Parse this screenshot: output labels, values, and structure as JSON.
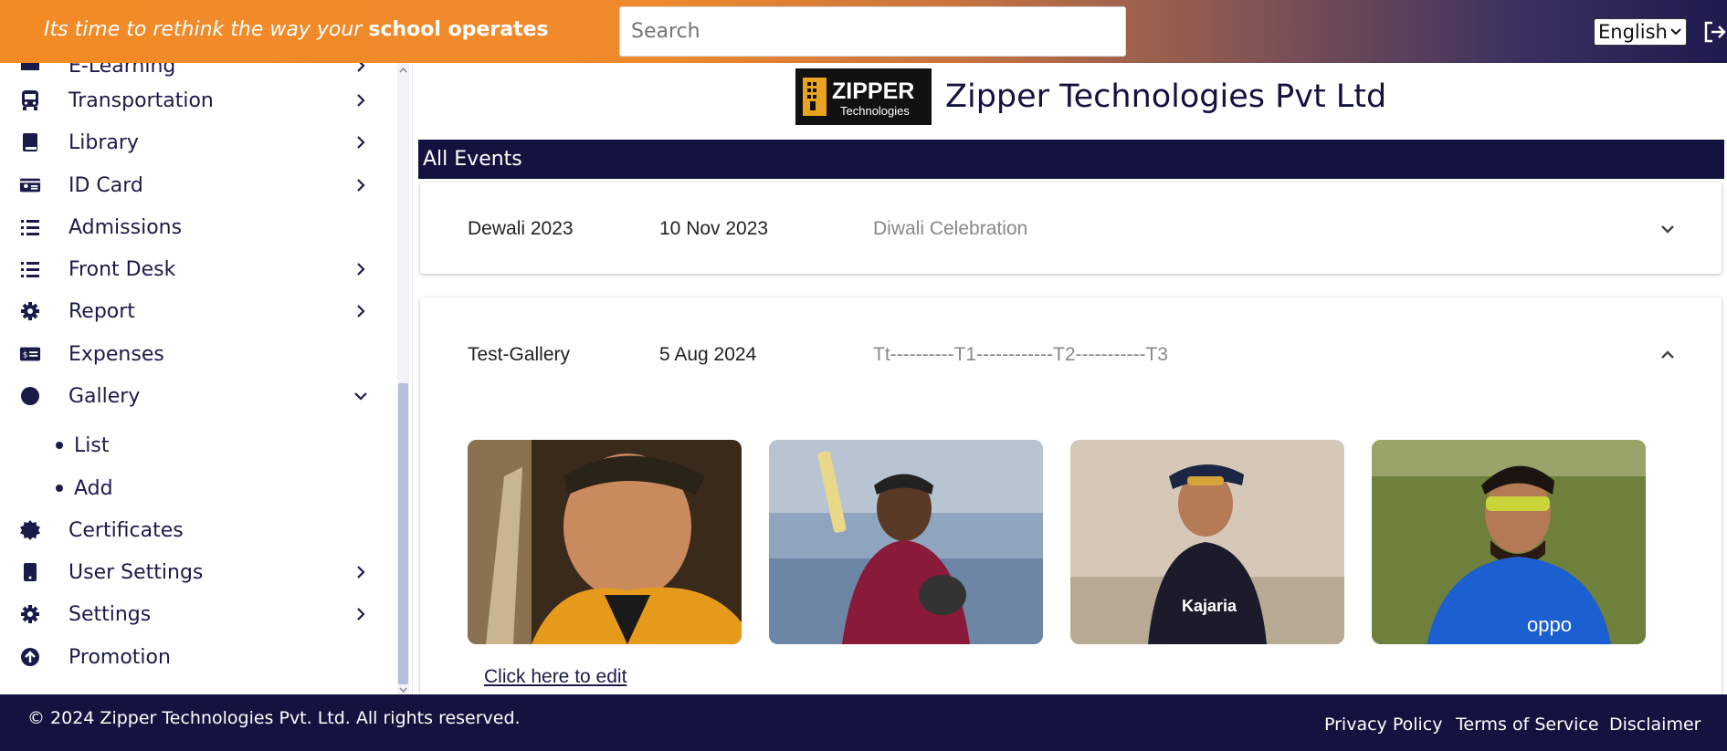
{
  "header": {
    "tagline_italic": "Its time to rethink the way your ",
    "tagline_bold": "school operates",
    "search_placeholder": "Search",
    "language": "English"
  },
  "sidebar": {
    "top_partial_label": "E-Learning",
    "items": [
      {
        "label": "Transportation",
        "icon": "bus-icon"
      },
      {
        "label": "Library",
        "icon": "book-icon"
      },
      {
        "label": "ID Card",
        "icon": "id-card-icon"
      },
      {
        "label": "Admissions",
        "icon": "list-icon"
      },
      {
        "label": "Front Desk",
        "icon": "list-icon"
      },
      {
        "label": "Report",
        "icon": "gear-icon"
      },
      {
        "label": "Expenses",
        "icon": "money-icon"
      },
      {
        "label": "Gallery",
        "icon": "circle-icon"
      },
      {
        "label": "Certificates",
        "icon": "certificate-icon"
      },
      {
        "label": "User Settings",
        "icon": "mobile-icon"
      },
      {
        "label": "Settings",
        "icon": "gear-icon"
      },
      {
        "label": "Promotion",
        "icon": "arrow-up-circle-icon"
      }
    ],
    "gallery_sub": [
      {
        "label": "List"
      },
      {
        "label": "Add"
      }
    ]
  },
  "main": {
    "brand_logo_text": "ZIPPER",
    "brand_logo_subtext": "Technologies",
    "brand_title": "Zipper Technologies Pvt Ltd",
    "section_title": "All Events",
    "events": [
      {
        "name": "Dewali 2023",
        "date": "10 Nov 2023",
        "description": "Diwali Celebration",
        "expanded": false
      },
      {
        "name": "Test-Gallery",
        "date": "5 Aug 2024",
        "description": "Tt----------T1------------T2-----------T3",
        "expanded": true
      }
    ],
    "edit_link": "Click here to edit"
  },
  "footer": {
    "copyright": "© 2024 Zipper Technologies Pvt. Ltd. All rights reserved.",
    "links": [
      "Privacy Policy",
      "Terms of Service",
      "Disclaimer"
    ]
  },
  "colors": {
    "navy": "#14133f",
    "orange": "#f28a26"
  }
}
